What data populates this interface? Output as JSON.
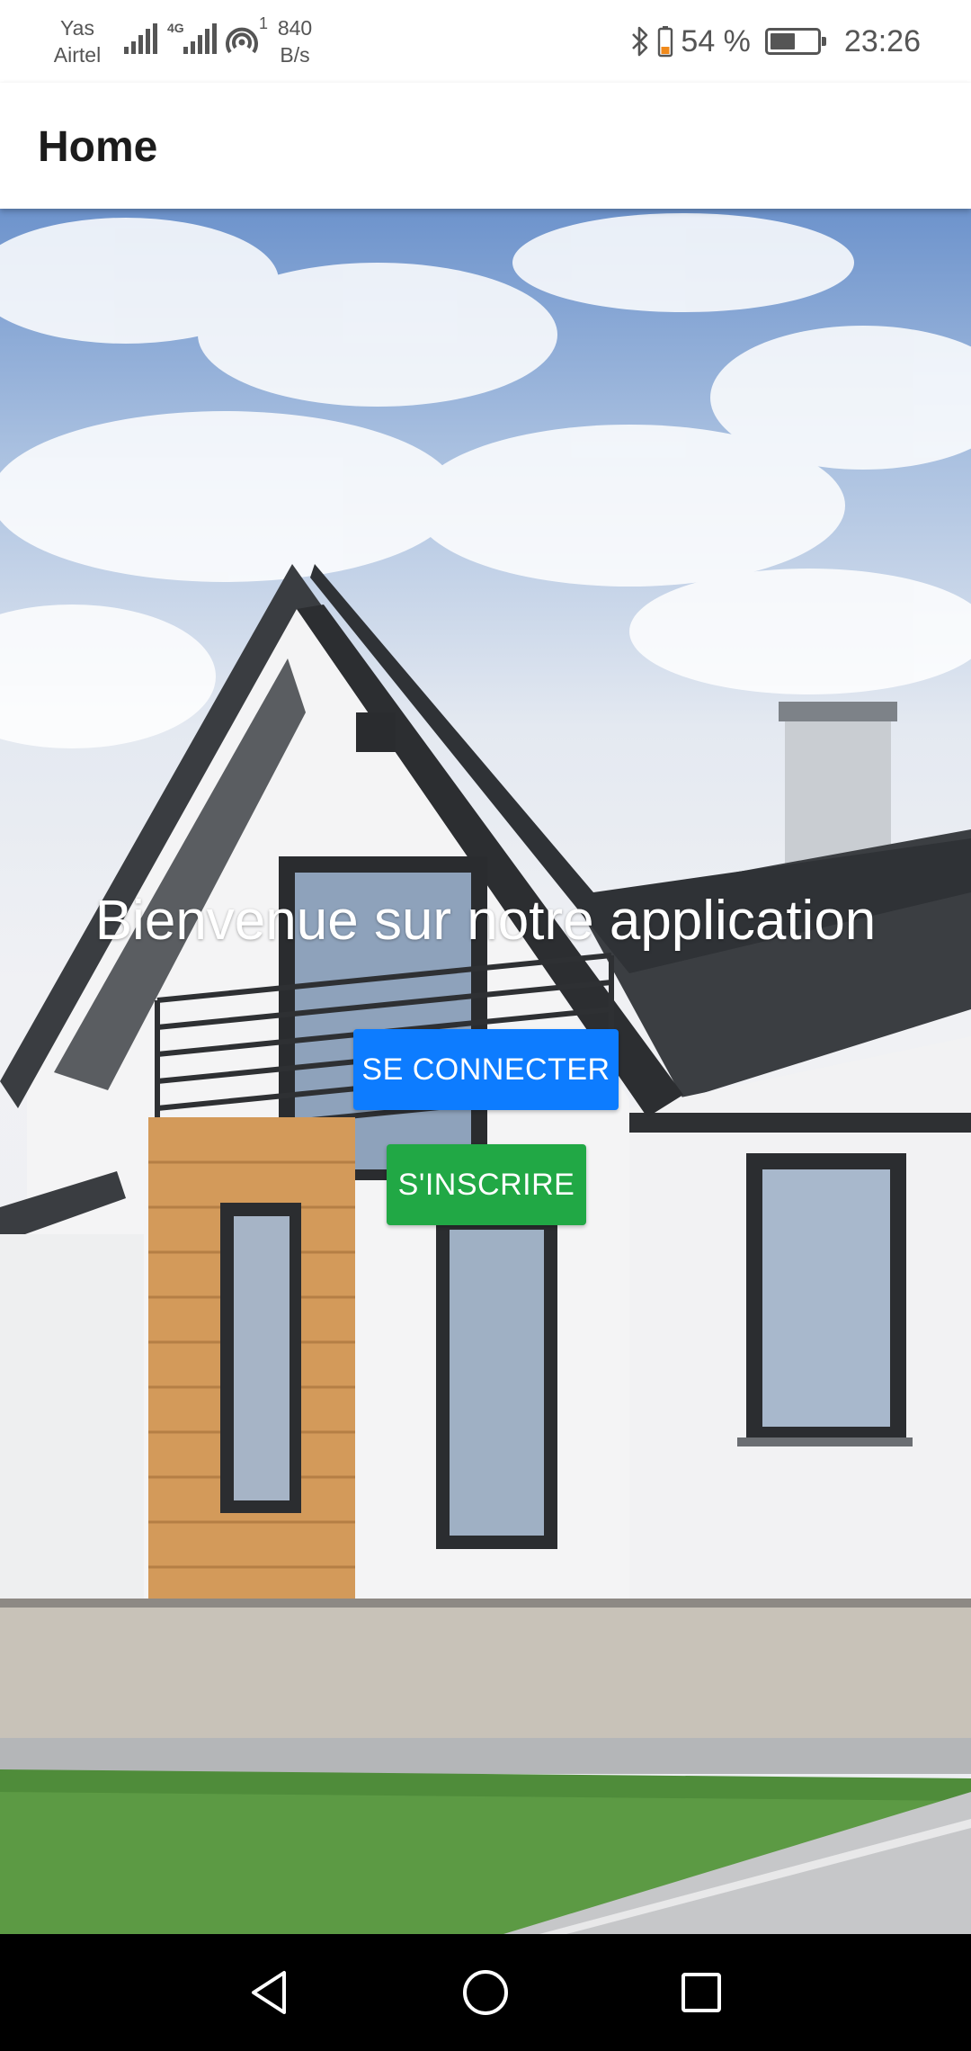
{
  "status_bar": {
    "carrier_line1": "Yas",
    "carrier_line2": "Airtel",
    "network_type": "4G",
    "hotspot_count": "1",
    "speed_value": "840",
    "speed_unit": "B/s",
    "battery_percent": "54 %",
    "battery_level": 0.54,
    "time": "23:26",
    "icons": [
      "signal-icon",
      "signal-4g-icon",
      "hotspot-icon",
      "bluetooth-icon",
      "battery-icon"
    ]
  },
  "app_bar": {
    "title": "Home"
  },
  "main": {
    "welcome_text": "Bienvenue sur notre application",
    "login_label": "SE CONNECTER",
    "signup_label": "S'INSCRIRE"
  },
  "colors": {
    "login_button": "#0d7cff",
    "signup_button": "#21a845",
    "nav_bar": "#000000"
  },
  "nav_bar": {
    "icons": [
      "back-icon",
      "home-icon",
      "recents-icon"
    ]
  }
}
